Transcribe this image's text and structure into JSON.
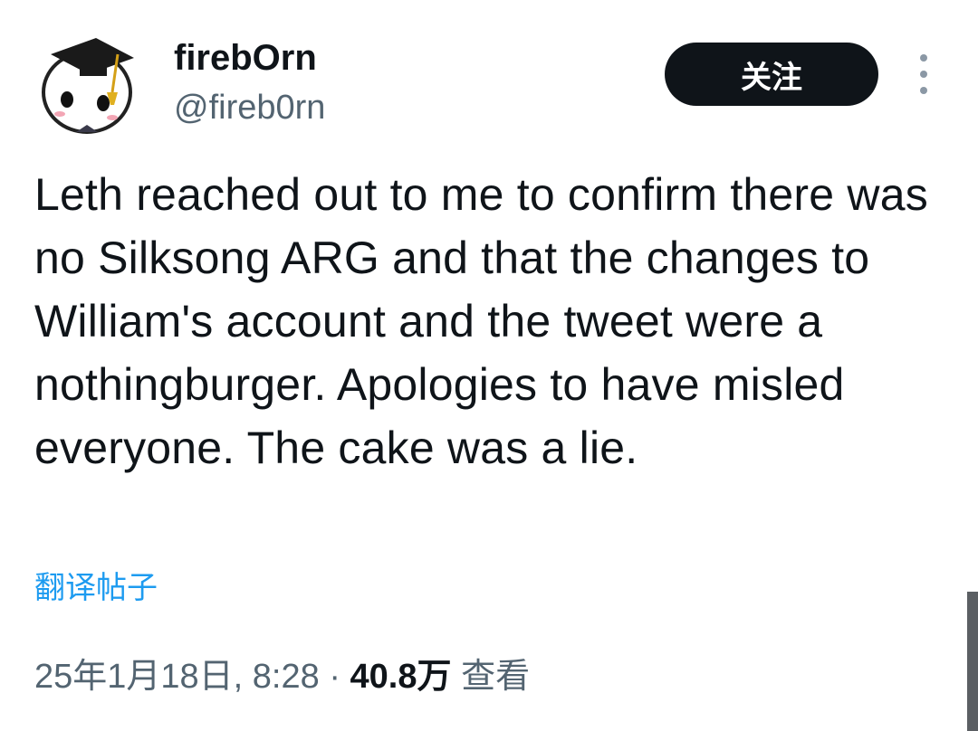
{
  "author": {
    "display_name": "firebOrn",
    "handle": "@fireb0rn",
    "avatar_icon": "avatar-graduation-cap-character"
  },
  "follow_button": {
    "label": "关注"
  },
  "more_icon": "more-vertical-icon",
  "tweet": {
    "text": "Leth reached out to me to confirm there was no Silksong ARG and that the changes to William's account and the tweet were a nothingburger. Apologies to have misled everyone. The cake was a lie."
  },
  "translate_label": "翻译帖子",
  "meta": {
    "date": "25年1月18日, 8:28",
    "separator": "·",
    "views_count": "40.8万",
    "views_label": "查看"
  },
  "colors": {
    "text_primary": "#0f1419",
    "text_secondary": "#536471",
    "link": "#1d9bf0",
    "button_bg": "#0f1419",
    "button_text": "#ffffff"
  }
}
